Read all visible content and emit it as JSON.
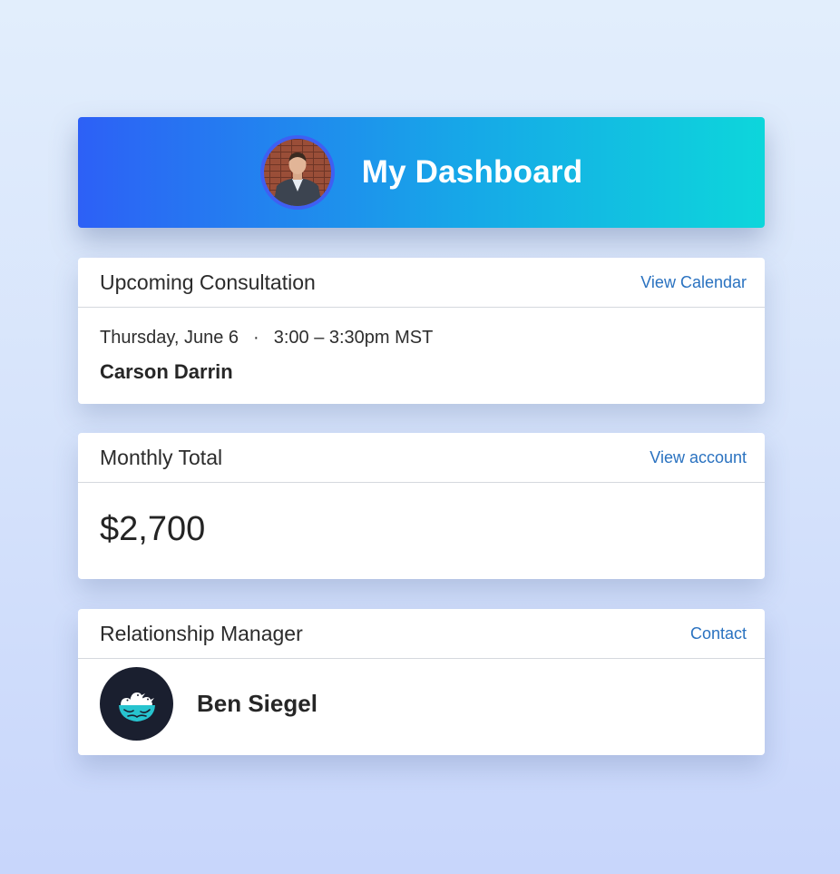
{
  "header": {
    "title": "My Dashboard",
    "avatar_icon": "user-photo-avatar"
  },
  "consultation": {
    "title": "Upcoming Consultation",
    "link": "View Calendar",
    "date": "Thursday, June 6",
    "separator": "·",
    "time": "3:00 – 3:30pm MST",
    "name": "Carson Darrin"
  },
  "monthly": {
    "title": "Monthly Total",
    "link": "View account",
    "amount": "$2,700"
  },
  "manager": {
    "title": "Relationship Manager",
    "link": "Contact",
    "name": "Ben Siegel",
    "logo_icon": "birds-nest-logo"
  },
  "colors": {
    "header_start": "#2d60f6",
    "header_end": "#0dd6db",
    "link": "#2a72c0",
    "logo_bg": "#1a1f2f",
    "logo_accent": "#27c4cf"
  }
}
